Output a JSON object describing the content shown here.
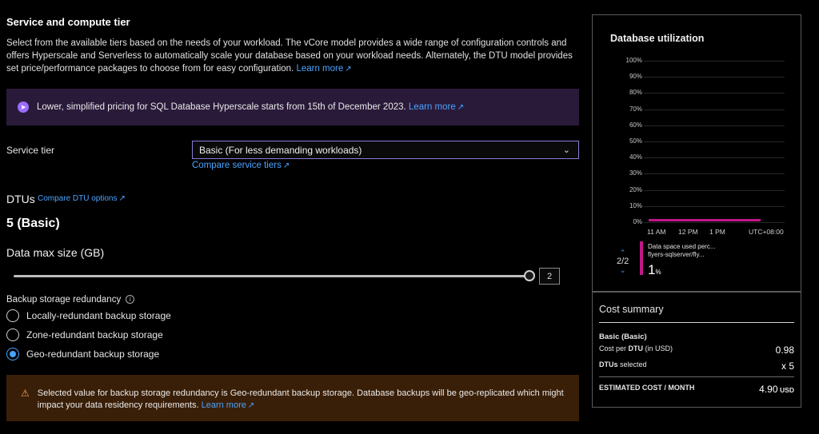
{
  "section": {
    "title": "Service and compute tier",
    "description": "Select from the available tiers based on the needs of your workload. The vCore model provides a wide range of configuration controls and offers Hyperscale and Serverless to automatically scale your database based on your workload needs. Alternately, the DTU model provides set price/performance packages to choose from for easy configuration.",
    "learn_more": "Learn more"
  },
  "banner": {
    "text": "Lower, simplified pricing for SQL Database Hyperscale starts from 15th of December 2023.",
    "link": "Learn more"
  },
  "service_tier": {
    "label": "Service tier",
    "value": "Basic (For less demanding workloads)",
    "compare_link": "Compare service tiers"
  },
  "dtus": {
    "label": "DTUs",
    "compare_link": "Compare DTU options",
    "value": "5 (Basic)"
  },
  "data_max_size": {
    "label": "Data max size (GB)",
    "value": "2",
    "fill_fraction": 1.0
  },
  "backup": {
    "label": "Backup storage redundancy",
    "options": [
      {
        "label": "Locally-redundant backup storage",
        "checked": false
      },
      {
        "label": "Zone-redundant backup storage",
        "checked": false
      },
      {
        "label": "Geo-redundant backup storage",
        "checked": true
      }
    ]
  },
  "warning": {
    "text": "Selected value for backup storage redundancy is Geo-redundant backup storage. Database backups will be geo-replicated which might impact your data residency requirements.",
    "link": "Learn more"
  },
  "utilization": {
    "title": "Database utilization",
    "pager": "2/2"
  },
  "chart_data": {
    "type": "line",
    "title": "Database utilization",
    "y_ticks": [
      "100%",
      "90%",
      "80%",
      "70%",
      "60%",
      "50%",
      "40%",
      "30%",
      "20%",
      "10%",
      "0%"
    ],
    "ylim": [
      0,
      100
    ],
    "x_ticks": [
      "11 AM",
      "12 PM",
      "1 PM"
    ],
    "timezone": "UTC+08:00",
    "series": [
      {
        "name": "Data space used perc... flyers-sqlserver/fly...",
        "values": [
          1,
          1,
          1,
          1
        ],
        "color": "#c2188a"
      }
    ],
    "legend_name_line1": "Data space used perc...",
    "legend_name_line2": "flyers-sqlserver/fly...",
    "legend_value": "1",
    "legend_unit": "%"
  },
  "cost": {
    "title": "Cost summary",
    "tier": "Basic (Basic)",
    "cost_per_label_prefix": "Cost per",
    "cost_per_label_bold": "DTU",
    "cost_per_label_suffix": "(in USD)",
    "cost_per_value": "0.98",
    "dtus_label_bold": "DTUs",
    "dtus_label_suffix": "selected",
    "dtus_value": "x 5",
    "estimated_label": "ESTIMATED COST / MONTH",
    "estimated_value": "4.90",
    "currency": "USD"
  },
  "colors": {
    "accent": "#4aa3ff",
    "series": "#c2188a",
    "banner_bg": "#2a1a3a",
    "warning_bg": "#3a1f08"
  }
}
